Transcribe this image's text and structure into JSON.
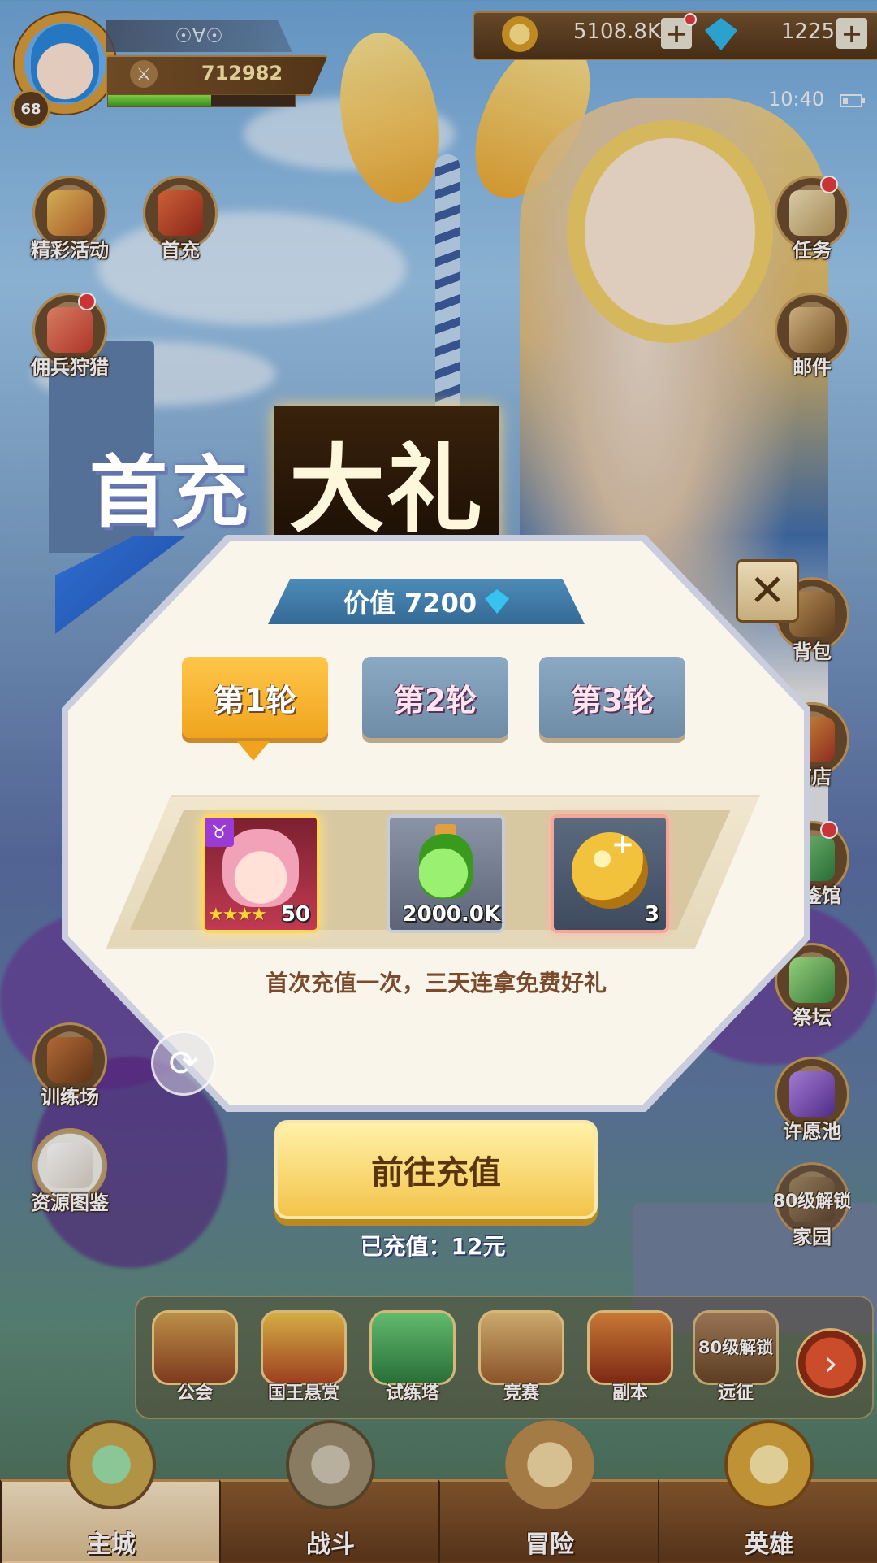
{
  "player": {
    "name": "☉∀☉",
    "level": "68",
    "power": "712982",
    "xp_fraction": 0.55
  },
  "currency": {
    "gold": "5108.8K",
    "gems": "1225",
    "plus": "+"
  },
  "status": {
    "time": "10:40"
  },
  "left_menu": [
    {
      "label": "精彩活动",
      "icon": "event-chest-icon"
    },
    {
      "label": "首充",
      "icon": "gift-box-icon"
    },
    {
      "label": "佣兵狩猎",
      "icon": "gift-box-icon"
    },
    {
      "label": "训练场",
      "icon": "training-icon"
    },
    {
      "label": "资源图鉴",
      "icon": "book-icon"
    }
  ],
  "right_menu": [
    {
      "label": "任务",
      "icon": "scroll-icon"
    },
    {
      "label": "邮件",
      "icon": "mail-icon"
    },
    {
      "label": "背包",
      "icon": "bag-icon"
    },
    {
      "label": "商店",
      "icon": "shop-icon"
    },
    {
      "label": "图鉴馆",
      "icon": "hall-icon"
    },
    {
      "label": "祭坛",
      "icon": "altar-icon"
    },
    {
      "label": "许愿池",
      "icon": "wish-pool-icon"
    },
    {
      "label": "家园",
      "icon": "home-icon",
      "lock": "80级解锁"
    }
  ],
  "function_bar": [
    {
      "label": "公会",
      "icon": "guild-shield-icon"
    },
    {
      "label": "国王悬赏",
      "icon": "crown-icon"
    },
    {
      "label": "试练塔",
      "icon": "tower-gem-icon"
    },
    {
      "label": "竞赛",
      "icon": "crossed-swords-icon"
    },
    {
      "label": "副本",
      "icon": "dungeon-icon"
    },
    {
      "label": "远征",
      "icon": "expedition-icon",
      "lock": "80级解锁"
    }
  ],
  "bottom_nav": [
    {
      "label": "主城",
      "icon": "city-icon",
      "active": true
    },
    {
      "label": "战斗",
      "icon": "battle-swords-icon",
      "active": false
    },
    {
      "label": "冒险",
      "icon": "adventure-map-icon",
      "active": false
    },
    {
      "label": "英雄",
      "icon": "hero-crest-icon",
      "active": false
    }
  ],
  "dialog": {
    "title_part1": "首充",
    "title_part2": "大礼",
    "value_label": "价值 7200",
    "close": "✕",
    "tabs": [
      {
        "label": "第1轮",
        "active": true
      },
      {
        "label": "第2轮",
        "active": false
      },
      {
        "label": "第3轮",
        "active": false
      }
    ],
    "rewards": [
      {
        "type": "hero-shard",
        "count": "50",
        "stars": "★★★★",
        "faction": "♉"
      },
      {
        "type": "potion",
        "count": "2000.0K"
      },
      {
        "type": "exp-orb",
        "count": "3"
      }
    ],
    "description": "首次充值一次，三天连拿免费好礼",
    "refresh": "⟳",
    "recharge_button": "前往充值",
    "charged_text": "已充值：12元"
  },
  "colors": {
    "active_tab": "#f0a41e",
    "inactive_tab": "#7c9ab3",
    "accent_blue": "#356a95",
    "reddot": "#e53a3a"
  }
}
